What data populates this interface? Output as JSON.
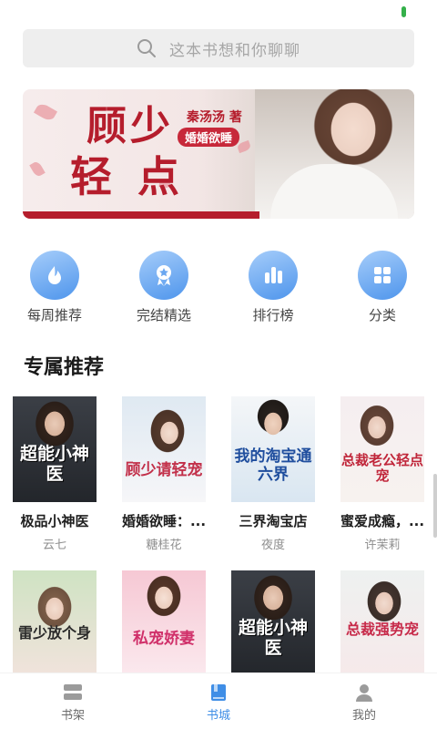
{
  "search": {
    "placeholder": "这本书想和你聊聊"
  },
  "banner": {
    "title_line1": "顾少",
    "title_line2": "轻点",
    "author": "秦汤汤 著",
    "subtitle": "婚婚欲睡"
  },
  "categories": [
    {
      "label": "每周推荐",
      "icon": "flame-icon"
    },
    {
      "label": "完结精选",
      "icon": "award-icon"
    },
    {
      "label": "排行榜",
      "icon": "bar-chart-icon"
    },
    {
      "label": "分类",
      "icon": "grid-icon"
    }
  ],
  "section": {
    "title": "专属推荐"
  },
  "books_row1": [
    {
      "title": "极品小神医",
      "author": "云七",
      "cover_text": "超能小神医"
    },
    {
      "title": "婚婚欲睡：...",
      "author": "糖桂花",
      "cover_text": "顾少请轻宠"
    },
    {
      "title": "三界淘宝店",
      "author": "夜度",
      "cover_text": "我的淘宝通六界"
    },
    {
      "title": "蜜爱成瘾，...",
      "author": "许茉莉",
      "cover_text": "总裁老公轻点宠"
    }
  ],
  "books_row2": [
    {
      "cover_text": "雷少放个身"
    },
    {
      "cover_text": "私宠娇妻"
    },
    {
      "cover_text": "超能小神医"
    },
    {
      "cover_text": "总裁强势宠"
    }
  ],
  "tabbar": [
    {
      "label": "书架",
      "icon": "bookshelf-icon",
      "active": false
    },
    {
      "label": "书城",
      "icon": "book-icon",
      "active": true
    },
    {
      "label": "我的",
      "icon": "user-icon",
      "active": false
    }
  ],
  "colors": {
    "accent": "#3f8ee6",
    "banner_red": "#b51d2c",
    "status_green": "#34b04a"
  }
}
